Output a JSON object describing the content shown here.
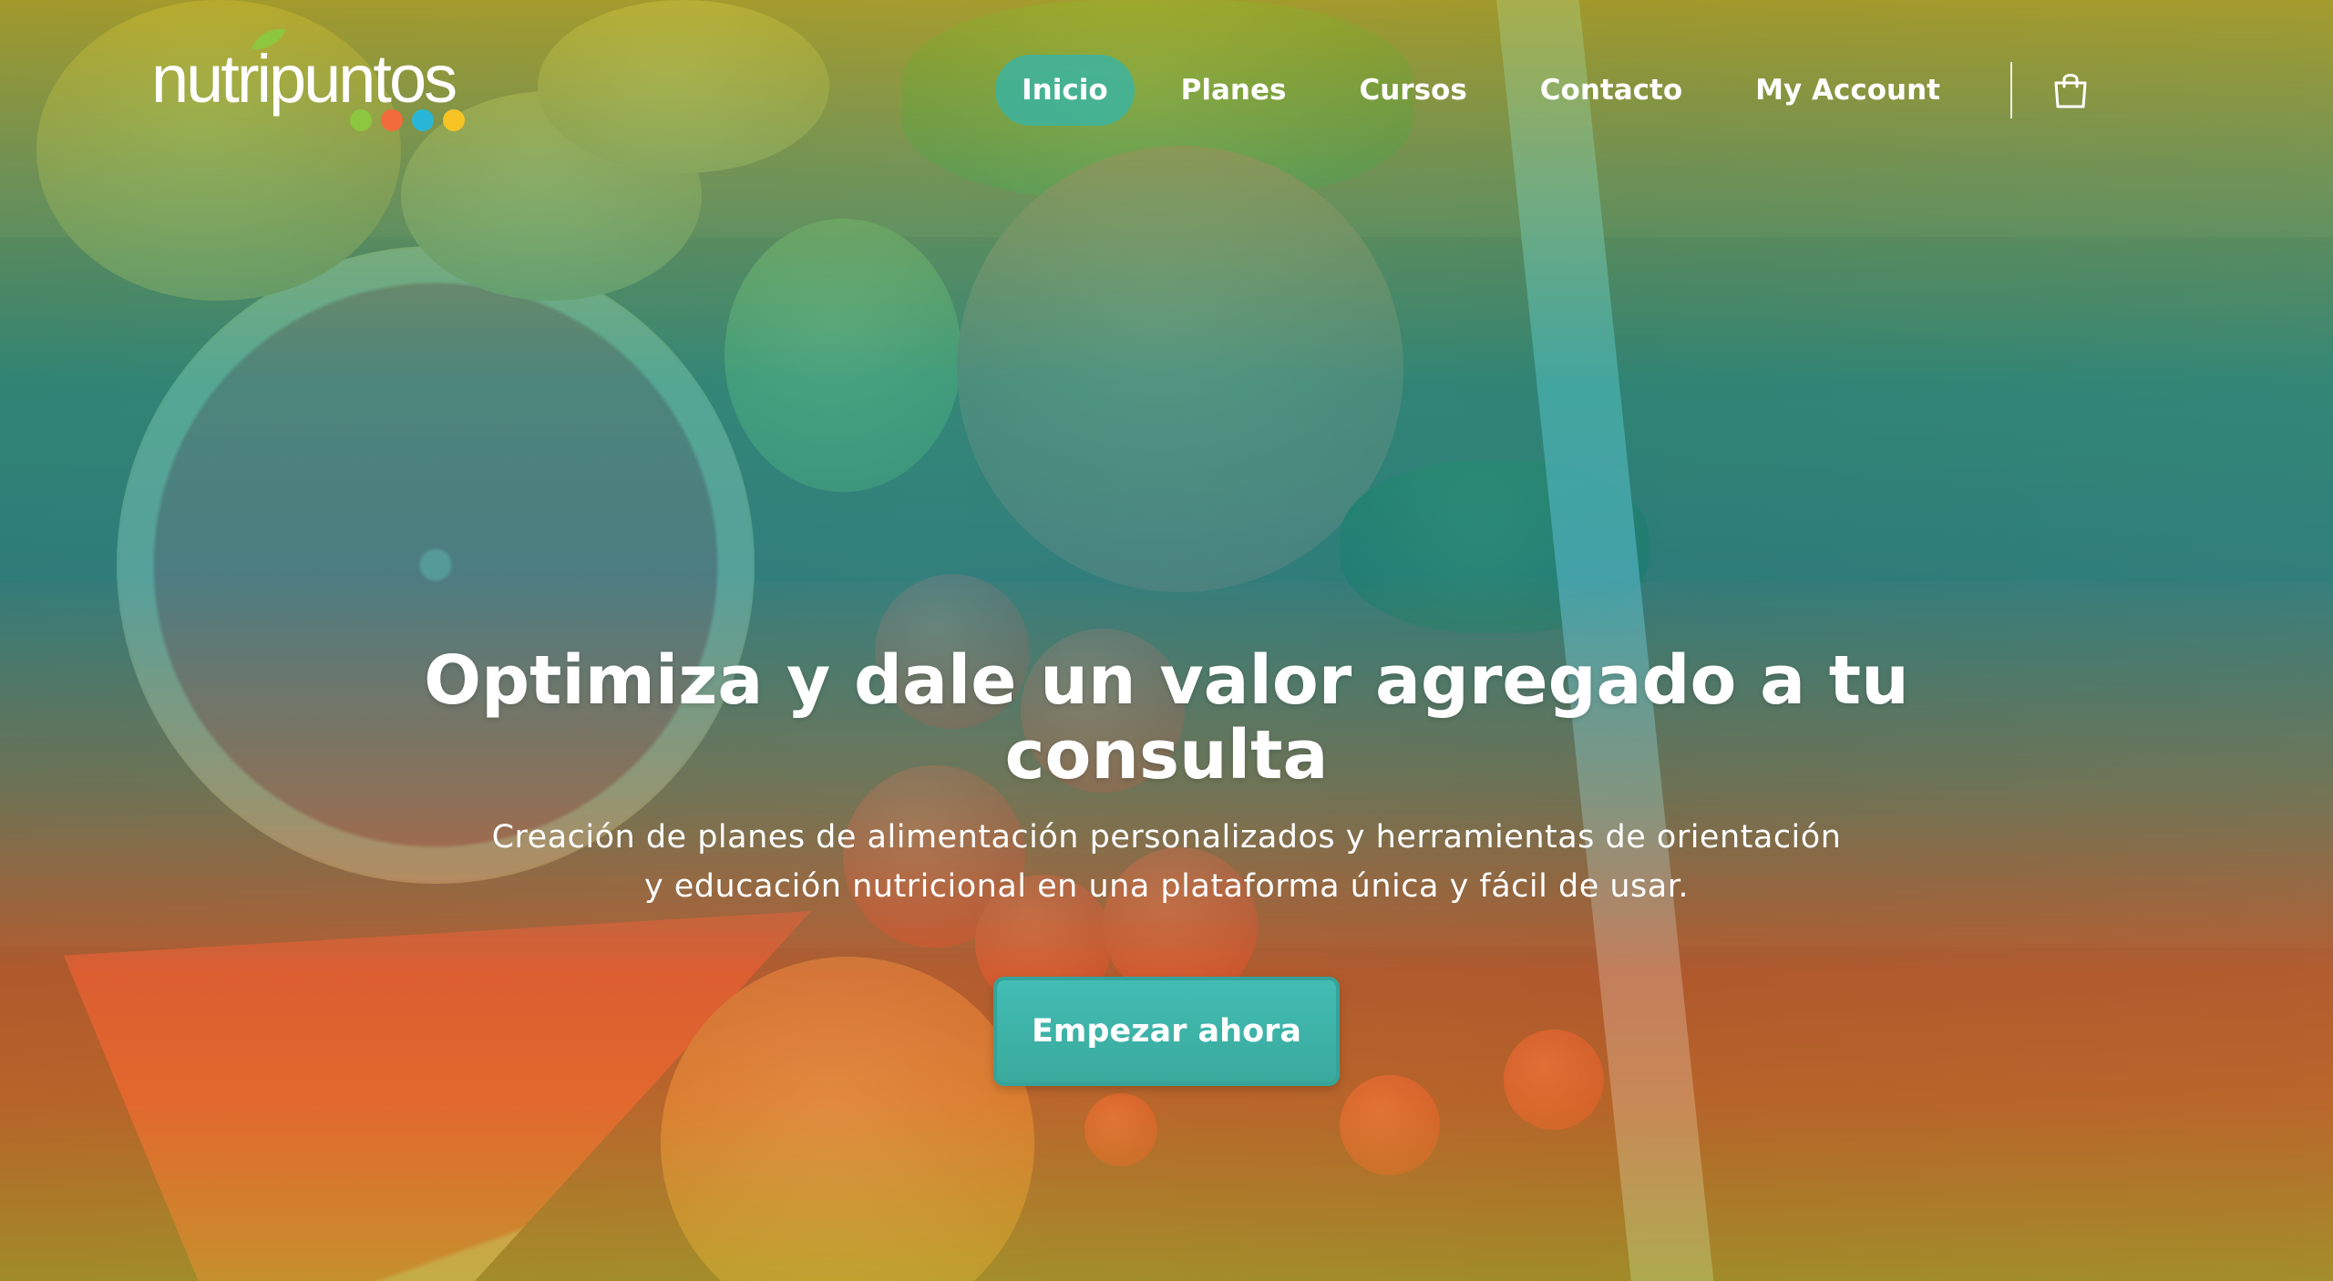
{
  "brand": {
    "logo_text": "nutripuntos",
    "dot_colors": [
      "#8dc63f",
      "#f26b3a",
      "#29b6d6",
      "#f7c325"
    ],
    "leaf_color": "#8dc63f"
  },
  "nav": {
    "items": [
      {
        "label": "Inicio",
        "active": true
      },
      {
        "label": "Planes",
        "active": false
      },
      {
        "label": "Cursos",
        "active": false
      },
      {
        "label": "Contacto",
        "active": false
      },
      {
        "label": "My Account",
        "active": false
      }
    ],
    "cart_icon": "shopping-bag-icon"
  },
  "hero": {
    "title_line1": "Optimiza y dale un valor agregado a tu",
    "title_line2": "consulta",
    "subtitle_line1": "Creación de planes de alimentación personalizados y herramientas de orientación",
    "subtitle_line2": "y educación nutricional en una plataforma única y fácil de usar.",
    "cta_label": "Empezar ahora",
    "accent_color": "#3fb5ab"
  }
}
